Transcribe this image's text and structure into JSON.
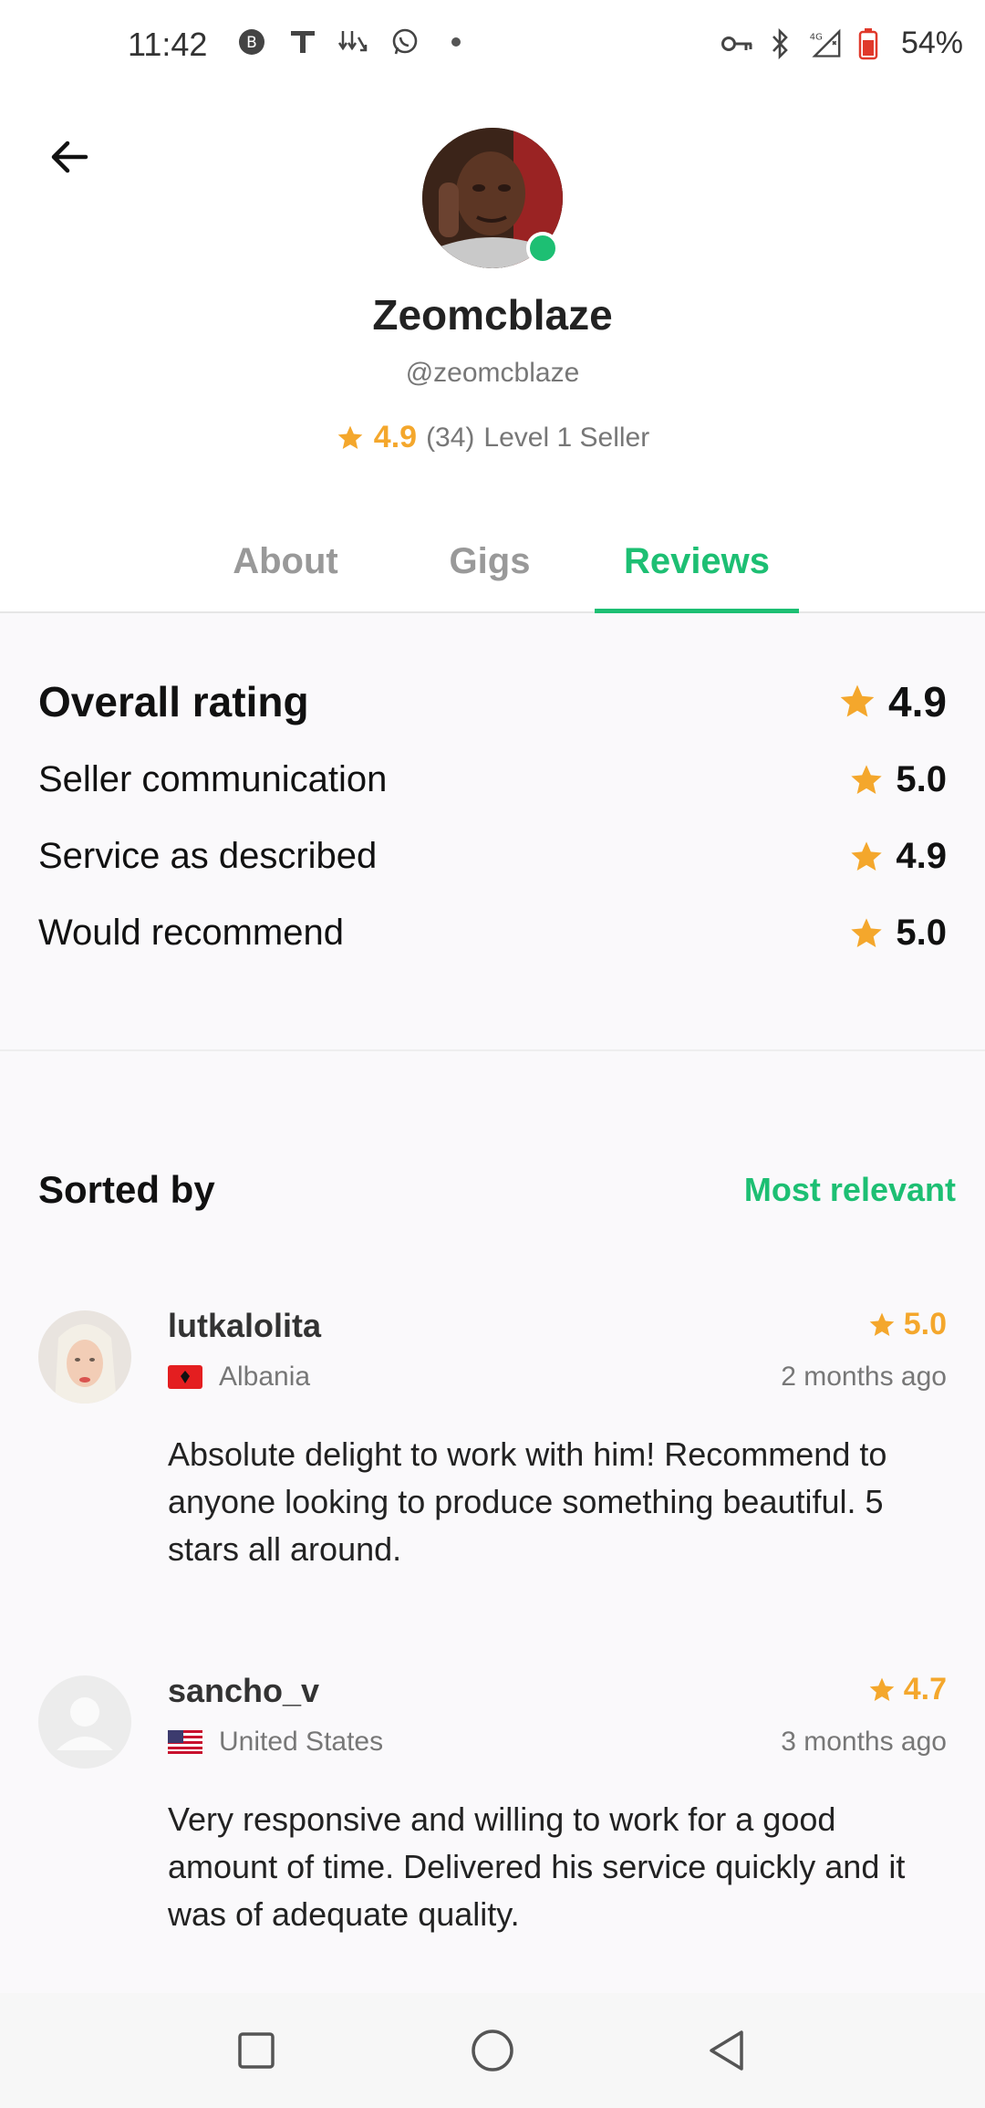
{
  "status_bar": {
    "time": "11:42",
    "network": "4G",
    "battery": "54%"
  },
  "profile": {
    "name": "Zeomcblaze",
    "handle": "@zeomcblaze",
    "rating": "4.9",
    "rating_count": "(34)",
    "level": "Level 1 Seller",
    "online_color": "#1dbf73"
  },
  "tabs": [
    {
      "label": "About"
    },
    {
      "label": "Gigs"
    },
    {
      "label": "Reviews",
      "active": true
    }
  ],
  "ratings": {
    "overall_label": "Overall rating",
    "overall_value": "4.9",
    "metrics": [
      {
        "label": "Seller communication",
        "value": "5.0"
      },
      {
        "label": "Service as described",
        "value": "4.9"
      },
      {
        "label": "Would recommend",
        "value": "5.0"
      }
    ]
  },
  "sort": {
    "label": "Sorted by",
    "value": "Most relevant"
  },
  "reviews": [
    {
      "username": "lutkalolita",
      "country": "Albania",
      "rating": "5.0",
      "time": "2 months ago",
      "text": "Absolute delight to work with him! Recommend to anyone looking to produce something beautiful. 5 stars all around."
    },
    {
      "username": "sancho_v",
      "country": "United States",
      "rating": "4.7",
      "time": "3 months ago",
      "text": "Very responsive and willing to work for a good amount of time. Delivered his service quickly and it was of adequate quality."
    }
  ],
  "colors": {
    "accent": "#1dbf73",
    "star": "#f4a72c"
  },
  "icons": [
    "back-arrow-icon",
    "star-icon",
    "nav-recents-icon",
    "nav-home-icon",
    "nav-back-icon"
  ]
}
